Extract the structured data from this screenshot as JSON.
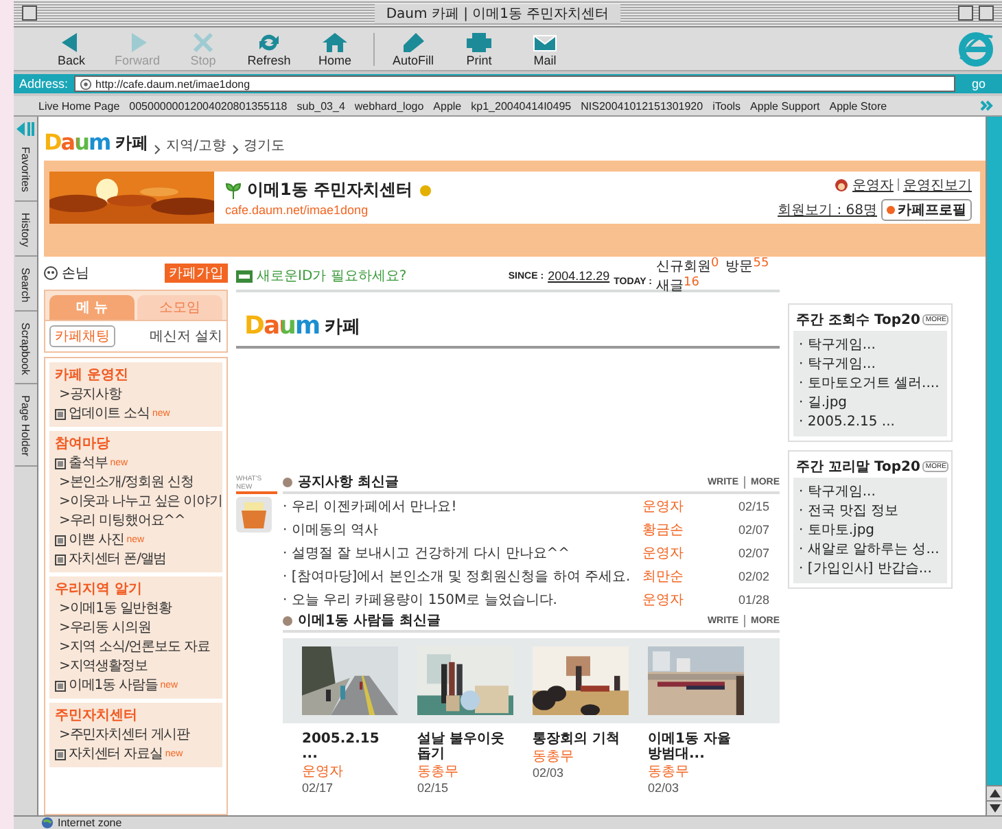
{
  "window": {
    "title": "Daum 카페 | 이메1동 주민자치센터"
  },
  "toolbar": [
    {
      "label": "Back",
      "disabled": false
    },
    {
      "label": "Forward",
      "disabled": true
    },
    {
      "label": "Stop",
      "disabled": true
    },
    {
      "label": "Refresh",
      "disabled": false
    },
    {
      "label": "Home",
      "disabled": false
    },
    {
      "label": "AutoFill",
      "disabled": false
    },
    {
      "label": "Print",
      "disabled": false
    },
    {
      "label": "Mail",
      "disabled": false
    }
  ],
  "address": {
    "label": "Address:",
    "value": "http://cafe.daum.net/imae1dong",
    "go": "go"
  },
  "favorites": [
    "Live Home Page",
    "00500000012004020801355118",
    "sub_03_4",
    "webhard_logo",
    "Apple",
    "kp1_20040414I0495",
    "NIS20041012151301920",
    "iTools",
    "Apple Support",
    "Apple Store"
  ],
  "explorer_tabs": [
    "Favorites",
    "History",
    "Search",
    "Scrapbook",
    "Page Holder"
  ],
  "breadcrumb": {
    "logo": "Daum",
    "cafe": "카페",
    "path": [
      "지역/고향",
      "경기도"
    ]
  },
  "cafe": {
    "title": "이메1동 주민자치센터",
    "url": "cafe.daum.net/imae1dong",
    "links": [
      "운영자",
      "운영진보기"
    ],
    "members": "회원보기 : 68명",
    "profile": "카페프로필"
  },
  "user": {
    "name": "손님",
    "join": "카페가입"
  },
  "menu_tabs": [
    {
      "label": "메 뉴",
      "selected": true
    },
    {
      "label": "소모임",
      "selected": false
    }
  ],
  "chat": "카페채팅",
  "messenger": "메신저 설치",
  "sections": [
    {
      "title": "카페 운영진",
      "items": [
        {
          "kind": "board",
          "label": ">공지사항"
        },
        {
          "kind": "album",
          "label": "업데이트 소식",
          "badge": "new"
        }
      ]
    },
    {
      "title": "참여마당",
      "items": [
        {
          "kind": "album",
          "label": "출석부",
          "badge": "new"
        },
        {
          "kind": "board",
          "label": ">본인소개/정회원 신청"
        },
        {
          "kind": "board",
          "label": ">이웃과 나누고 싶은 이야기"
        },
        {
          "kind": "board",
          "label": ">우리 미팅했어요^^"
        },
        {
          "kind": "album",
          "label": "이쁜 사진",
          "badge": "new"
        },
        {
          "kind": "album",
          "label": "자치센터 폰/앨범"
        }
      ]
    },
    {
      "title": "우리지역 알기",
      "items": [
        {
          "kind": "board",
          "label": ">이메1동 일반현황"
        },
        {
          "kind": "board",
          "label": ">우리동 시의원"
        },
        {
          "kind": "board",
          "label": ">지역 소식/언론보도 자료"
        },
        {
          "kind": "board",
          "label": ">지역생활정보"
        },
        {
          "kind": "album",
          "label": "이메1동 사람들",
          "badge": "new"
        }
      ]
    },
    {
      "title": "주민자치센터",
      "items": [
        {
          "kind": "board",
          "label": ">주민자치센터 게시판"
        },
        {
          "kind": "album",
          "label": "자치센터 자료실",
          "badge": "new"
        }
      ]
    }
  ],
  "notice": "새로운ID가 필요하세요?",
  "banner_logo": {
    "logo": "Daum",
    "cafe": "카페"
  },
  "since": {
    "label": "SINCE :",
    "date": "2004.12.29",
    "today": "TODAY :"
  },
  "stats": [
    {
      "label": "신규회원",
      "value": "0"
    },
    {
      "label": "방문",
      "value": "55"
    },
    {
      "label": "새글",
      "value": "16"
    }
  ],
  "whats_new": "WHAT'S NEW",
  "boards": [
    {
      "kind": "list",
      "title": "공지사항 최신글",
      "write": "WRITE",
      "more": "MORE",
      "posts": [
        {
          "title": "· 우리 이젠카페에서 만나요!",
          "author": "운영자",
          "date": "02/15"
        },
        {
          "title": "· 이메동의 역사",
          "author": "황금손",
          "date": "02/07"
        },
        {
          "title": "· 설명절 잘 보내시고 건강하게 다시 만나요^^",
          "author": "운영자",
          "date": "02/07"
        },
        {
          "title": "· [참여마당]에서 본인소개 및 정회원신청을 하여 주세요.",
          "author": "최만순",
          "date": "02/02"
        },
        {
          "title": "· 오늘 우리 카페용량이 150M로 늘었습니다.",
          "author": "운영자",
          "date": "01/28"
        }
      ]
    },
    {
      "kind": "gallery",
      "title": "이메1동 사람들 최신글",
      "write": "WRITE",
      "more": "MORE",
      "posts": [
        {
          "title": "2005.2.15 ...",
          "author": "운영자",
          "date": "02/17"
        },
        {
          "title": "설날 불우이웃 돕기",
          "author": "동총무",
          "date": "02/15"
        },
        {
          "title": "통장회의 기척",
          "author": "동총무",
          "date": "02/03"
        },
        {
          "title": "이메1동 자율방범대...",
          "author": "동총무",
          "date": "02/03"
        }
      ]
    }
  ],
  "rankings": [
    {
      "title": "주간 조회수 Top20",
      "more": "MORE",
      "items": [
        "· 탁구게임...",
        "· 탁구게임...",
        "· 토마토오거트 셀러....",
        "· 길.jpg",
        "· 2005.2.15 ..."
      ]
    },
    {
      "title": "주간 꼬리말 Top20",
      "more": "MORE",
      "items": [
        "· 탁구게임...",
        "· 전국 맛집 정보",
        "· 토마토.jpg",
        "· 새알로 알하루는 성...",
        "· [가입인사] 반갑습..."
      ]
    }
  ],
  "status": "Internet zone"
}
